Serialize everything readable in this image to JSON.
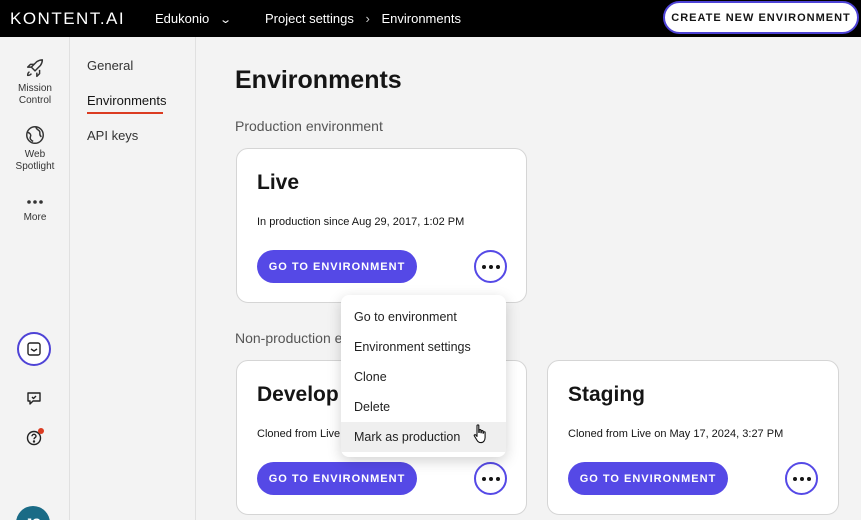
{
  "topbar": {
    "logo": "KONTENT.AI",
    "project": "Edukonio",
    "breadcrumb": [
      "Project settings",
      "Environments"
    ],
    "create_button": "CREATE NEW ENVIRONMENT"
  },
  "rail": {
    "items": [
      {
        "label_line1": "Mission",
        "label_line2": "Control",
        "icon": "rocket-icon"
      },
      {
        "label_line1": "Web",
        "label_line2": "Spotlight",
        "icon": "globe-icon"
      },
      {
        "label_line1": "More",
        "label_line2": "",
        "icon": "more-dots-icon"
      }
    ],
    "avatar_initials": "JC"
  },
  "subnav": {
    "items": [
      "General",
      "Environments",
      "API keys"
    ],
    "active": "Environments"
  },
  "main": {
    "title": "Environments",
    "production_label": "Production environment",
    "nonproduction_label": "Non-production e",
    "live": {
      "name": "Live",
      "meta": "In production since Aug 29, 2017, 1:02 PM",
      "button": "GO TO ENVIRONMENT"
    },
    "develop": {
      "name": "Develop",
      "meta": "Cloned from Live o",
      "button": "GO TO ENVIRONMENT"
    },
    "staging": {
      "name": "Staging",
      "meta": "Cloned from Live on May 17, 2024, 3:27 PM",
      "button": "GO TO ENVIRONMENT"
    }
  },
  "menu": {
    "items": [
      "Go to environment",
      "Environment settings",
      "Clone",
      "Delete",
      "Mark as production"
    ],
    "hovered": "Mark as production"
  },
  "colors": {
    "accent": "#5549e6",
    "active_underline": "#db3b21",
    "avatar": "#1a6b86"
  }
}
